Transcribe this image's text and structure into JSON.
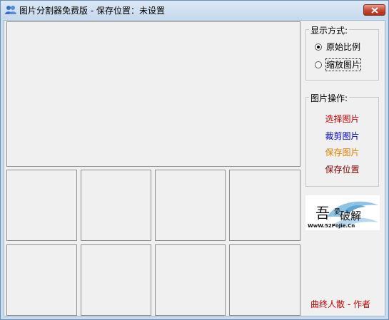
{
  "window": {
    "title": "图片分割器免费版 - 保存位置：未设置"
  },
  "display_mode": {
    "title": "显示方式:",
    "options": [
      {
        "label": "原始比例",
        "checked": true
      },
      {
        "label": "缩放图片",
        "checked": false
      }
    ]
  },
  "image_ops": {
    "title": "图片操作:",
    "items": [
      {
        "label": "选择图片",
        "color": "#c00000"
      },
      {
        "label": "裁剪图片",
        "color": "#0000c0"
      },
      {
        "label": "保存图片",
        "color": "#e08000"
      },
      {
        "label": "保存位置",
        "color": "#800000"
      }
    ]
  },
  "logo": {
    "text_main": "吾",
    "text_small": "WwW.52PoJie.Cn"
  },
  "author": "曲终人散 - 作者",
  "colors": {
    "titlebar": "#c6d9ed",
    "client_bg": "#f0f0f0",
    "close_button": "#c6452e"
  },
  "grid": {
    "rows": 2,
    "cols": 4
  }
}
